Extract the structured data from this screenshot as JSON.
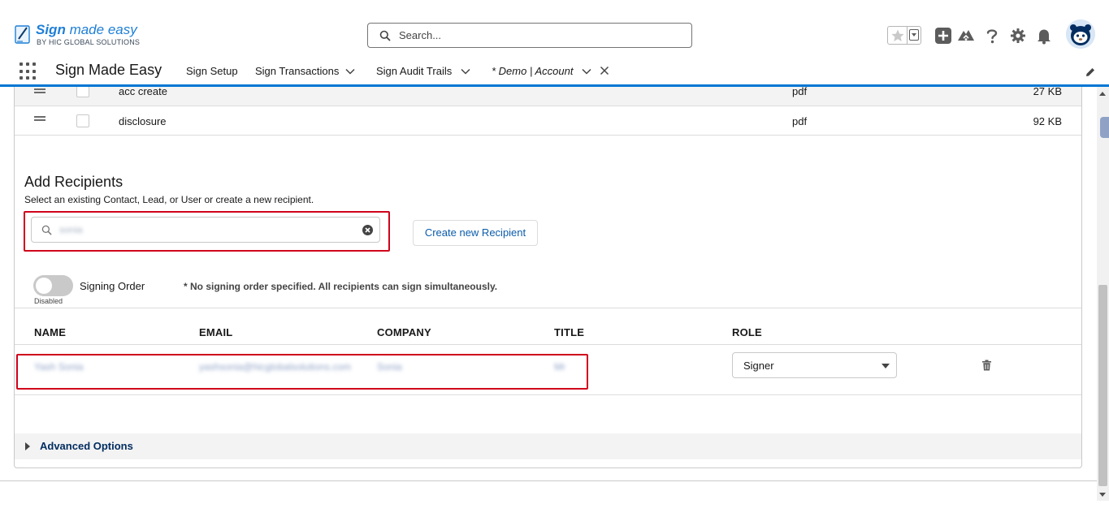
{
  "header": {
    "logo": {
      "title_bold": "Sign",
      "title_rest": " made easy",
      "subtitle": "BY HIC GLOBAL SOLUTIONS"
    },
    "search": {
      "placeholder": "Search..."
    },
    "icons": [
      "star-icon",
      "chevron-down-icon",
      "add-icon",
      "trailhead-icon",
      "help-icon",
      "setup-gear-icon",
      "notification-bell-icon",
      "avatar"
    ]
  },
  "nav": {
    "app_name": "Sign Made Easy",
    "items": [
      {
        "label": "Sign Setup",
        "has_menu": false
      },
      {
        "label": "Sign Transactions",
        "has_menu": true
      },
      {
        "label": "Sign Audit Trails",
        "has_menu": true
      }
    ],
    "active_tab": {
      "label": "* Demo | Account"
    }
  },
  "files": [
    {
      "name": "acc create",
      "type": "pdf",
      "size": "27 KB"
    },
    {
      "name": "disclosure",
      "type": "pdf",
      "size": "92 KB"
    }
  ],
  "recipients": {
    "title": "Add Recipients",
    "subtitle": "Select an existing Contact, Lead, or User or create a new recipient.",
    "search_value": "sonia",
    "create_button": "Create new Recipient",
    "toggle": {
      "label": "Signing Order",
      "state_text": "Disabled",
      "enabled": false
    },
    "order_note": "* No signing order specified. All recipients can sign simultaneously.",
    "columns": {
      "name": "NAME",
      "email": "EMAIL",
      "company": "COMPANY",
      "title": "TITLE",
      "role": "ROLE"
    },
    "rows": [
      {
        "name": "Yash Sonia",
        "email": "yashsonia@hicglobalsolutions.com",
        "company": "Sonia",
        "title": "Mr",
        "role": "Signer"
      }
    ]
  },
  "advanced": {
    "label": "Advanced Options"
  },
  "colors": {
    "accent": "#0176d3",
    "highlight": "#d0021b",
    "link": "#0b5cab"
  }
}
